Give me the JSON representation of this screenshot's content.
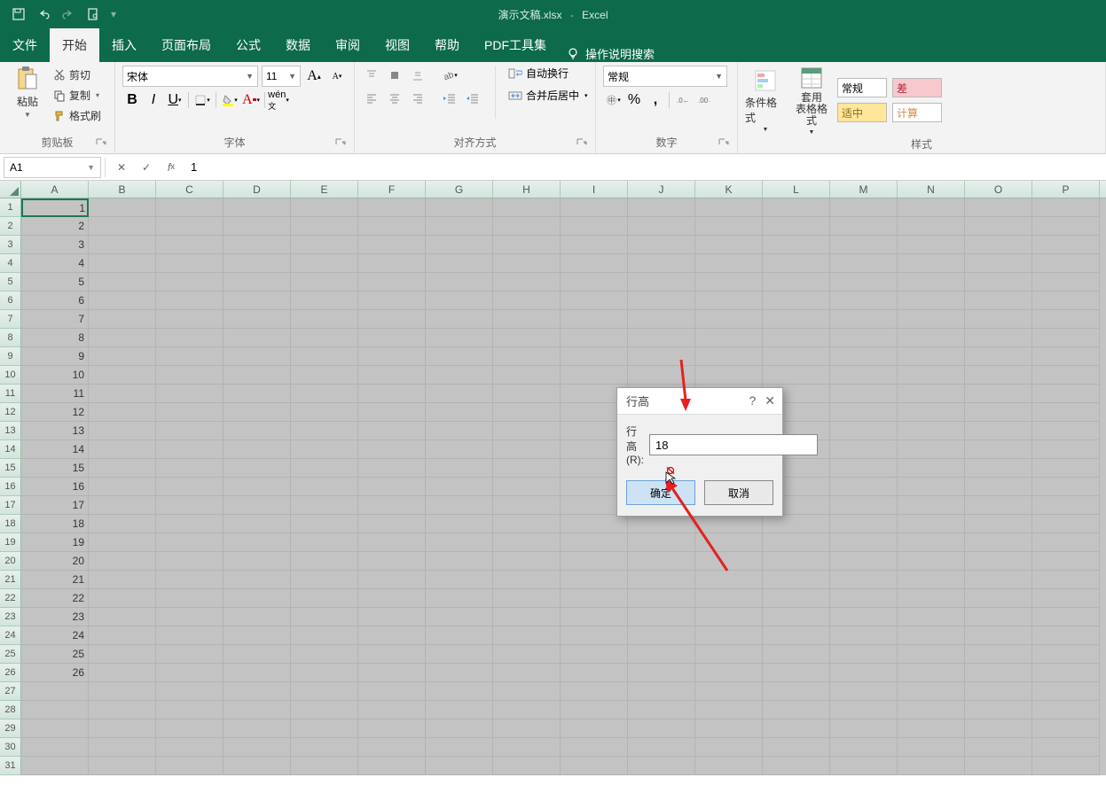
{
  "title": {
    "filename": "演示文稿.xlsx",
    "app": "Excel"
  },
  "tabs": [
    "文件",
    "开始",
    "插入",
    "页面布局",
    "公式",
    "数据",
    "审阅",
    "视图",
    "帮助",
    "PDF工具集"
  ],
  "tabs_active_index": 1,
  "tell_me": "操作说明搜索",
  "clipboard": {
    "paste": "粘贴",
    "cut": "剪切",
    "copy": "复制",
    "format_painter": "格式刷",
    "group": "剪贴板"
  },
  "font": {
    "name": "宋体",
    "size": "11",
    "group": "字体"
  },
  "align": {
    "wrap": "自动换行",
    "merge": "合并后居中",
    "group": "对齐方式"
  },
  "number": {
    "format": "常规",
    "percent": "%",
    "group": "数字"
  },
  "styles": {
    "cond": "条件格式",
    "table": "套用\n表格格式",
    "normal": "常规",
    "bad": "差",
    "good": "适中",
    "calc": "计算",
    "group": "样式"
  },
  "formula_bar": {
    "namebox": "A1",
    "value": "1"
  },
  "columns": [
    "A",
    "B",
    "C",
    "D",
    "E",
    "F",
    "G",
    "H",
    "I",
    "J",
    "K",
    "L",
    "M",
    "N",
    "O",
    "P"
  ],
  "row_count": 31,
  "data_cells": {
    "count": 26
  },
  "dialog": {
    "title": "行高",
    "label": "行高(R):",
    "value": "18",
    "ok": "确定",
    "cancel": "取消"
  }
}
